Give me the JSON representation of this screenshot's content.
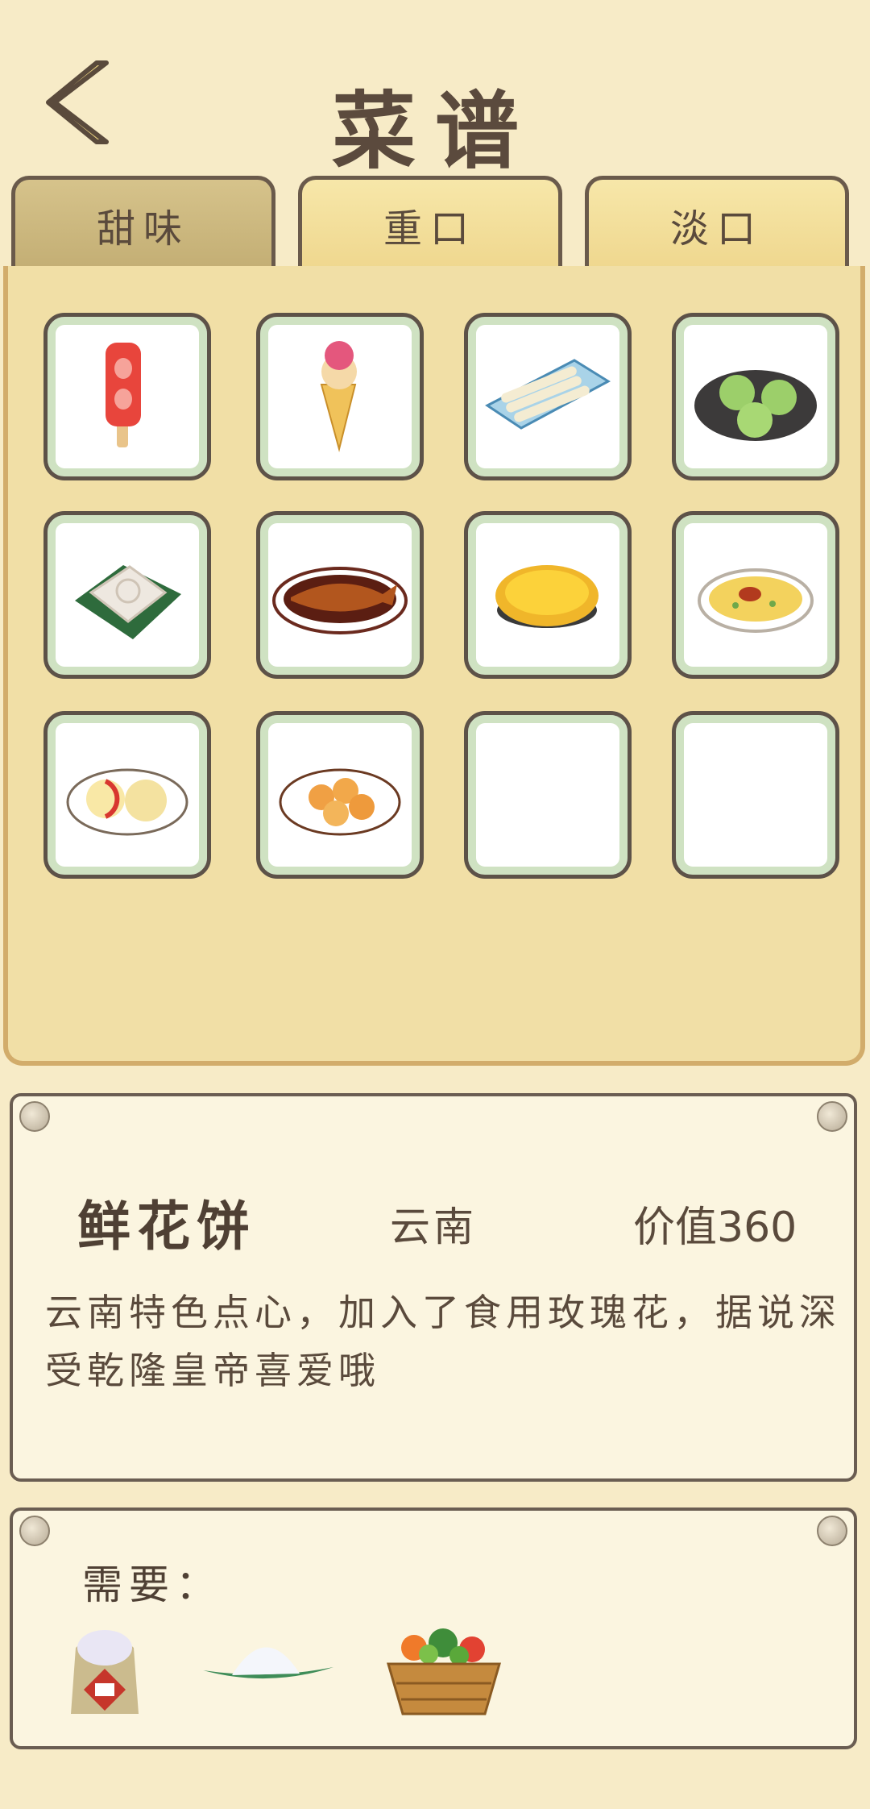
{
  "title": "菜谱",
  "tabs": [
    {
      "label": "甜味",
      "active": true
    },
    {
      "label": "重口",
      "active": false
    },
    {
      "label": "淡口",
      "active": false
    }
  ],
  "recipes": [
    {
      "icon": "strawberry-popsicle-icon",
      "unlocked": true
    },
    {
      "icon": "ice-cream-cone-icon",
      "unlocked": true
    },
    {
      "icon": "rice-roll-plate-icon",
      "unlocked": true
    },
    {
      "icon": "green-dumplings-icon",
      "unlocked": true
    },
    {
      "icon": "rice-cake-on-leaf-icon",
      "unlocked": true
    },
    {
      "icon": "braised-fish-icon",
      "unlocked": true
    },
    {
      "icon": "egg-tart-icon",
      "unlocked": true
    },
    {
      "icon": "omelette-plate-icon",
      "unlocked": true
    },
    {
      "icon": "flower-cake-plate-icon",
      "unlocked": true
    },
    {
      "icon": "fried-buns-plate-icon",
      "unlocked": true
    },
    {
      "icon": "",
      "unlocked": false
    },
    {
      "icon": "",
      "unlocked": false
    }
  ],
  "detail": {
    "name": "鲜花饼",
    "origin": "云南",
    "value": "价值360",
    "description": "云南特色点心，加入了食用玫瑰花，据说深受乾隆皇帝喜爱哦"
  },
  "requirements": {
    "label": "需要：",
    "items": [
      "flour-sack-icon",
      "rice-on-leaf-icon",
      "vegetable-basket-icon"
    ]
  },
  "colors": {
    "background": "#f7ebc7",
    "panel": "#f1dfa6",
    "tab_active": "#c3ae74",
    "tab_inactive": "#efd78e",
    "cell_inner_ring": "#cfe2c2",
    "text": "#5a4a3c"
  }
}
